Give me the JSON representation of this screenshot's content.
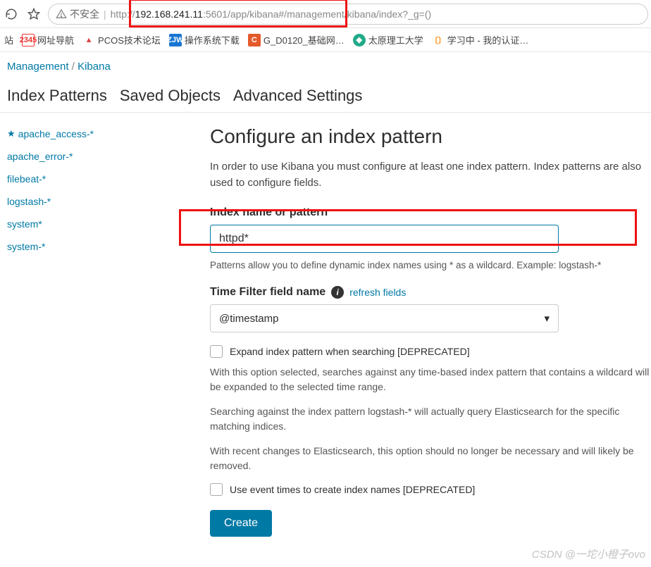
{
  "browser": {
    "insecure_label": "不安全",
    "url_prefix": "http://",
    "url_host": "192.168.241.11",
    "url_port": ":5601",
    "url_rest": "/app/kibana#/management/kibana/index?_g=()"
  },
  "bookmarks": [
    {
      "label": "站"
    },
    {
      "label": "网址导航"
    },
    {
      "label": "PCOS技术论坛"
    },
    {
      "label": "操作系统下载"
    },
    {
      "label": "G_D0120_基础网…"
    },
    {
      "label": "太原理工大学"
    },
    {
      "label": "学习中 - 我的认证…"
    }
  ],
  "breadcrumbs": {
    "management": "Management",
    "sep": "/",
    "kibana": "Kibana"
  },
  "tabs": {
    "index_patterns": "Index Patterns",
    "saved_objects": "Saved Objects",
    "advanced": "Advanced Settings"
  },
  "sidebar": {
    "items": [
      {
        "label": "apache_access-*",
        "default": true
      },
      {
        "label": "apache_error-*"
      },
      {
        "label": "filebeat-*"
      },
      {
        "label": "logstash-*"
      },
      {
        "label": "system*"
      },
      {
        "label": "system-*"
      }
    ]
  },
  "main": {
    "title": "Configure an index pattern",
    "intro": "In order to use Kibana you must configure at least one index pattern. Index patterns are also used to configure fields.",
    "index_label": "Index name or pattern",
    "index_value": "httpd*",
    "index_helper_1": "Patterns allow you to define dynamic index names using * as a wildcard. Example: logstash-*",
    "time_filter_label": "Time Filter field name",
    "refresh_link": "refresh fields",
    "time_filter_value": "@timestamp",
    "expand_label": "Expand index pattern when searching [DEPRECATED]",
    "expand_desc1": "With this option selected, searches against any time-based index pattern that contains a wildcard will be expanded to the selected time range.",
    "expand_desc2_a": "Searching against the index pattern ",
    "expand_desc2_em": "logstash-*",
    "expand_desc2_b": " will actually query Elasticsearch for the specific matching indices.",
    "expand_desc3": "With recent changes to Elasticsearch, this option should no longer be necessary and will likely be removed.",
    "event_times_label": "Use event times to create index names [DEPRECATED]",
    "create_button": "Create"
  },
  "watermark": "CSDN @一坨小橙子ovo"
}
